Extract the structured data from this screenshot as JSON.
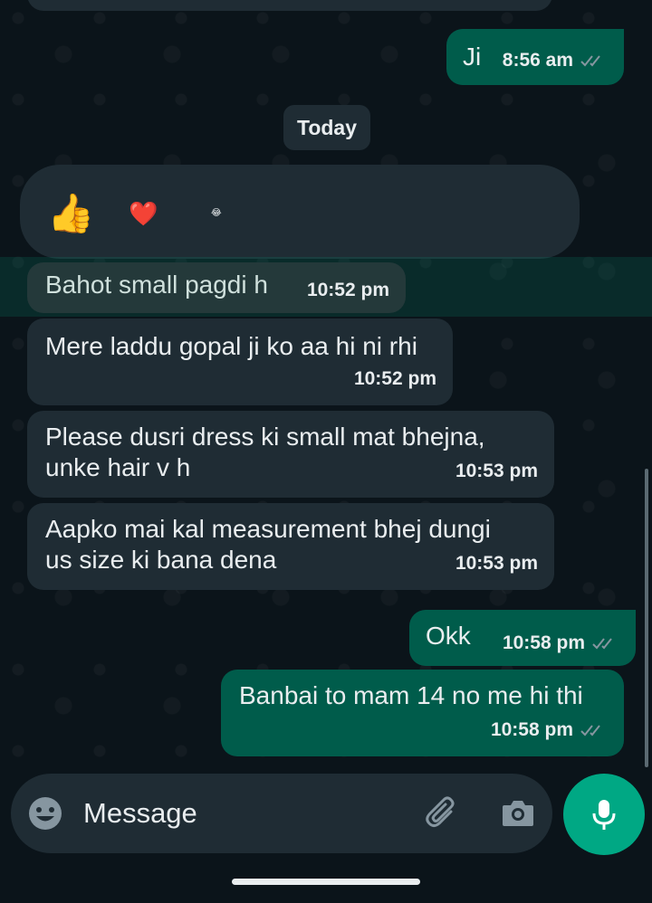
{
  "messages": {
    "ji": {
      "text": "Ji",
      "time": "8:56 am"
    },
    "reactions": {
      "thumbs": "👍",
      "heart": "❤️",
      "small": "😂"
    },
    "m1": {
      "text": "Bahot small pagdi h",
      "time": "10:52 pm"
    },
    "m2": {
      "text": "Mere laddu gopal ji ko aa hi ni rhi",
      "time": "10:52 pm"
    },
    "m3": {
      "line1": "Please dusri dress ki small mat bhejna,",
      "line2": "unke hair v h",
      "time": "10:53 pm"
    },
    "m4": {
      "line1": "Aapko mai kal measurement bhej dungi",
      "line2": "us size ki bana dena",
      "time": "10:53 pm"
    },
    "m5": {
      "text": "Okk",
      "time": "10:58 pm"
    },
    "m6": {
      "text": "Banbai to mam 14 no me hi thi",
      "time": "10:58 pm"
    }
  },
  "date_chip": "Today",
  "composer": {
    "placeholder": "Message"
  },
  "icons": {
    "emoji": "emoji-icon",
    "attach": "paperclip-icon",
    "camera": "camera-icon",
    "mic": "mic-icon"
  },
  "colors": {
    "incoming": "#1f2c34",
    "outgoing": "#005c4b",
    "accent": "#00a884",
    "background": "#0b141a"
  }
}
